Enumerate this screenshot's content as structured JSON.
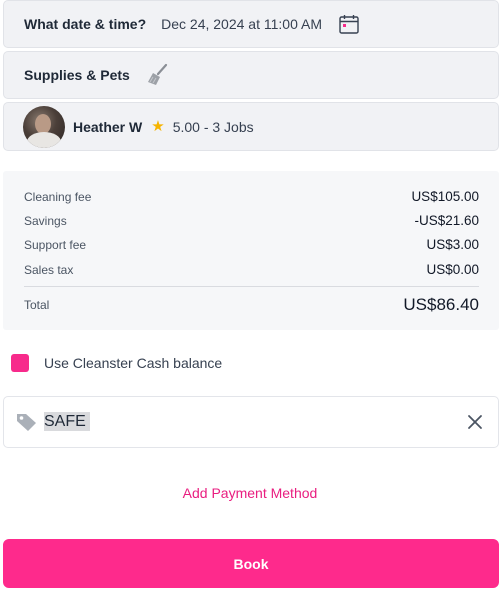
{
  "booking": {
    "datetime_label": "What date & time?",
    "datetime_value": "Dec 24, 2024 at 11:00 AM",
    "supplies_label": "Supplies & Pets",
    "cleaner_name": "Heather W",
    "cleaner_rating": "5.00 - 3 Jobs"
  },
  "fees": {
    "rows": [
      {
        "label": "Cleaning fee",
        "amount": "US$105.00"
      },
      {
        "label": "Savings",
        "amount": "-US$21.60"
      },
      {
        "label": "Support fee",
        "amount": "US$3.00"
      },
      {
        "label": "Sales tax",
        "amount": "US$0.00"
      }
    ],
    "total_label": "Total",
    "total_amount": "US$86.40"
  },
  "cash": {
    "label": "Use Cleanster Cash balance",
    "checked": true
  },
  "promo": {
    "value": "SAFE"
  },
  "actions": {
    "add_payment": "Add Payment Method",
    "book": "Book"
  },
  "colors": {
    "accent": "#fe2a8c",
    "link": "#e91e80",
    "star": "#f6b400"
  },
  "icons": {
    "calendar": "calendar-icon",
    "broom": "broom-icon",
    "star": "star-icon",
    "tag": "tag-icon",
    "clear": "close-icon"
  }
}
